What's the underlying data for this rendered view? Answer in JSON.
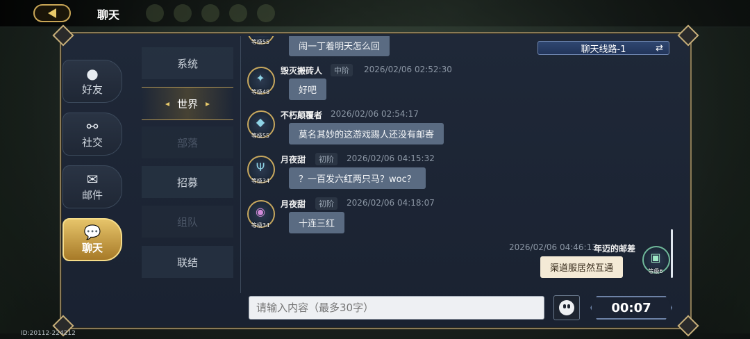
{
  "header": {
    "title": "聊天"
  },
  "footer": {
    "id_text": "ID:20112-224212"
  },
  "side_tabs": [
    {
      "label": "好友",
      "icon": "friend-icon"
    },
    {
      "label": "社交",
      "icon": "social-icon"
    },
    {
      "label": "邮件",
      "icon": "mail-icon"
    },
    {
      "label": "聊天",
      "icon": "chat-icon",
      "active": true
    }
  ],
  "channels": [
    {
      "label": "系统"
    },
    {
      "label": "世界",
      "active": true
    },
    {
      "label": "部落",
      "disabled": true
    },
    {
      "label": "招募"
    },
    {
      "label": "组队",
      "disabled": true
    },
    {
      "label": "联结"
    }
  ],
  "route": {
    "label": "聊天线路-1",
    "swap_icon": "swap-arrows-icon"
  },
  "messages": [
    {
      "text": "闹一丁着明天怎么回",
      "level": "等级55",
      "partial": true
    },
    {
      "name": "毁灭搬砖人",
      "rank": "中阶",
      "time": "2026/02/06 02:52:30",
      "text": "好吧",
      "level": "等级48"
    },
    {
      "name": "不朽颠覆者",
      "rank": "",
      "time": "2026/02/06 02:54:17",
      "text": "莫名其妙的这游戏踢人还没有邮寄",
      "level": "等级55"
    },
    {
      "name": "月夜甜",
      "rank": "初阶",
      "time": "2026/02/06 04:15:32",
      "text": "？一百发六红两只马？woc？",
      "level": "等级34"
    },
    {
      "name": "月夜甜",
      "rank": "初阶",
      "time": "2026/02/06 04:18:07",
      "text": "十连三红",
      "level": "等级34"
    },
    {
      "name": "年迈的邮差",
      "rank": "",
      "time": "2026/02/06 04:46:13",
      "text": "渠道服居然互通",
      "level": "等级6",
      "self": true
    }
  ],
  "input": {
    "placeholder": "请输入内容（最多30字）"
  },
  "send": {
    "label": "00:07"
  },
  "colors": {
    "accent_gold": "#e6c46a",
    "bubble": "#5a6b82",
    "bubble_self": "#f4ead6",
    "panel": "#1f2838"
  }
}
